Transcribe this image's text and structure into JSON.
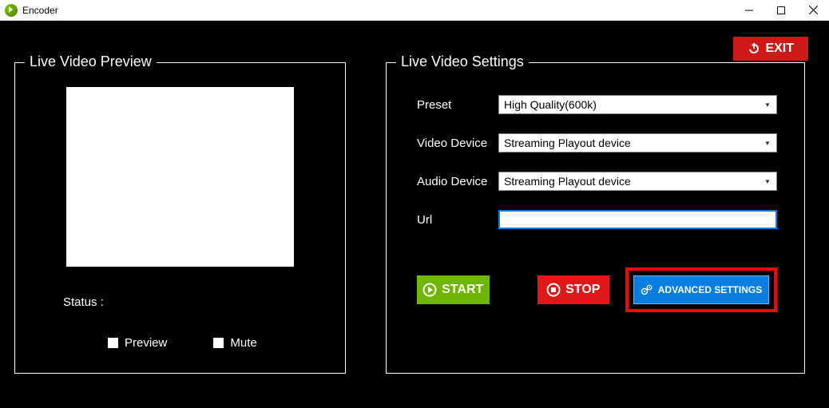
{
  "window": {
    "title": "Encoder"
  },
  "exit": {
    "label": "EXIT"
  },
  "preview": {
    "legend": "Live Video Preview",
    "status_label": "Status :",
    "status_value": "",
    "preview_label": "Preview",
    "mute_label": "Mute",
    "preview_checked": false,
    "mute_checked": false
  },
  "settings": {
    "legend": "Live Video Settings",
    "preset_label": "Preset",
    "preset_value": "High Quality(600k)",
    "video_device_label": "Video Device",
    "video_device_value": "Streaming Playout device",
    "audio_device_label": "Audio Device",
    "audio_device_value": "Streaming Playout device",
    "url_label": "Url",
    "url_value": "",
    "start_label": "START",
    "stop_label": "STOP",
    "advanced_label": "ADVANCED SETTINGS"
  }
}
